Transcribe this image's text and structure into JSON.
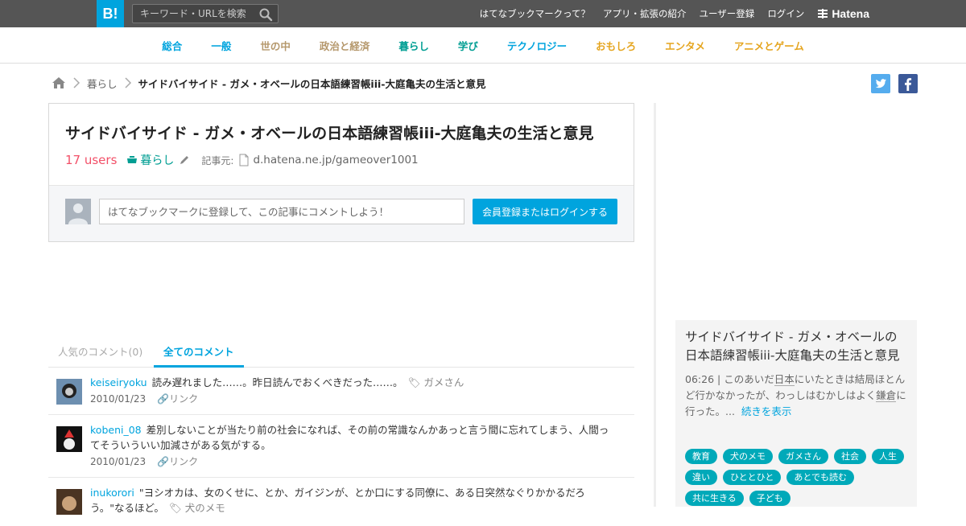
{
  "header": {
    "logo": "B!",
    "search_placeholder": "キーワード・URLを検索",
    "links": [
      "はてなブックマークって？",
      "アプリ・拡張の紹介",
      "ユーザー登録",
      "ログイン"
    ],
    "brand": "Hatena"
  },
  "categories": [
    {
      "label": "総合",
      "color": "#00a4de"
    },
    {
      "label": "一般",
      "color": "#00a4de"
    },
    {
      "label": "世の中",
      "color": "#b5986c"
    },
    {
      "label": "政治と経済",
      "color": "#b5986c"
    },
    {
      "label": "暮らし",
      "color": "#009e93"
    },
    {
      "label": "学び",
      "color": "#009e93"
    },
    {
      "label": "テクノロジー",
      "color": "#00a4de"
    },
    {
      "label": "おもしろ",
      "color": "#e5a51f"
    },
    {
      "label": "エンタメ",
      "color": "#e5a51f"
    },
    {
      "label": "アニメとゲーム",
      "color": "#e5a51f"
    }
  ],
  "breadcrumb": {
    "category": "暮らし",
    "current": "サイドバイサイド - ガメ・オベールの日本語練習帳iii-大庭亀夫の生活と意見"
  },
  "entry": {
    "title": "サイドバイサイド - ガメ・オベールの日本語練習帳iii-大庭亀夫の生活と意見",
    "users": "17 users",
    "category": "暮らし",
    "source_label": "記事元:",
    "source": "d.hatena.ne.jp/gameover1001"
  },
  "comment_form": {
    "placeholder": "はてなブックマークに登録して、この記事にコメントしよう！",
    "button": "会員登録またはログインする"
  },
  "tabs": {
    "popular": "人気のコメント(0)",
    "all": "全てのコメント"
  },
  "comments": [
    {
      "user": "keiseiryoku",
      "text": "読み遅れました……。昨日読んでおくべきだった……。",
      "tag": "ガメさん",
      "date": "2010/01/23",
      "link": "リンク"
    },
    {
      "user": "kobeni_08",
      "text": "差別しないことが当たり前の社会になれば、その前の常識なんかあっと言う間に忘れてしまう、人間ってそういういい加減さがある気がする。",
      "tag": "",
      "date": "2010/01/23",
      "link": "リンク"
    },
    {
      "user": "inukorori",
      "text": "\"ヨシオカは、女のくせに、とか、ガイジンが、とか口にする同僚に、ある日突然なぐりかかるだろう。\"なるほど。",
      "tag": "犬のメモ",
      "date": "",
      "link": ""
    }
  ],
  "sidebar": {
    "title": "サイドバイサイド - ガメ・オベールの日本語練習帳iii-大庭亀夫の生活と意見",
    "time": "06:26 |",
    "desc_parts": [
      {
        "t": "このあいだ",
        "kw": false
      },
      {
        "t": "日本",
        "kw": true
      },
      {
        "t": "にいたときは結局ほとんど行かなかったが、わっしはむかしはよく",
        "kw": false
      },
      {
        "t": "鎌倉",
        "kw": true
      },
      {
        "t": "に行った。...",
        "kw": false
      }
    ],
    "more": "続きを表示",
    "tags": [
      "教育",
      "犬のメモ",
      "ガメさん",
      "社会",
      "人生",
      "違い",
      "ひととひと",
      "あとでも読む",
      "共に生きる",
      "子ども"
    ]
  }
}
